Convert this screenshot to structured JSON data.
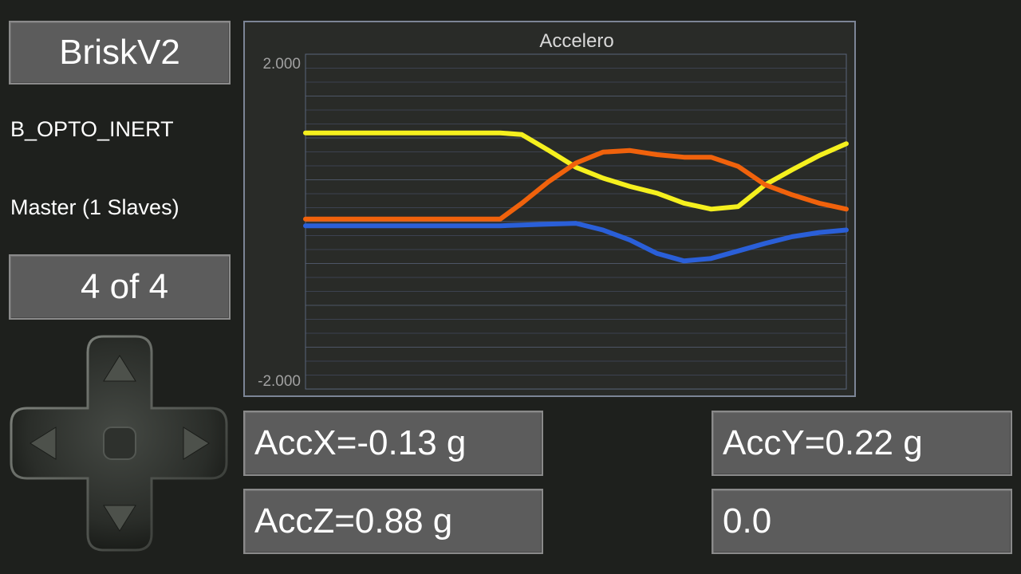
{
  "device": {
    "name": "BriskV2"
  },
  "sensor": {
    "name": "B_OPTO_INERT"
  },
  "network": {
    "role": "Master (1 Slaves)"
  },
  "pager": {
    "label": "4 of 4"
  },
  "dpad": {
    "up": "up-arrow",
    "down": "down-arrow",
    "left": "left-arrow",
    "right": "right-arrow",
    "center": "center-button"
  },
  "readouts": {
    "accx": "AccX=-0.13 g",
    "accy": "AccY=0.22 g",
    "accz": "AccZ=0.88 g",
    "extra": "0.0"
  },
  "colors": {
    "background": "#1e201d",
    "button": "#5c5c5c",
    "series_yellow": "#f5f01e",
    "series_orange": "#f0620c",
    "series_blue": "#2a5fd8"
  },
  "chart_data": {
    "type": "line",
    "title": "Accelero",
    "ylim": [
      -2.0,
      2.0
    ],
    "ytick_labels": [
      "2.000",
      "-2.000"
    ],
    "grid": true,
    "x": [
      0,
      5,
      10,
      15,
      20,
      25,
      30,
      33,
      36,
      40,
      45,
      50,
      55,
      60,
      65,
      70,
      75,
      80,
      85,
      90,
      95,
      100
    ],
    "series": [
      {
        "color": "#f5f01e",
        "values": [
          1.06,
          1.06,
          1.06,
          1.06,
          1.06,
          1.06,
          1.06,
          1.06,
          1.06,
          1.04,
          0.85,
          0.65,
          0.52,
          0.42,
          0.34,
          0.22,
          0.15,
          0.18,
          0.44,
          0.62,
          0.79,
          0.93
        ]
      },
      {
        "color": "#f0620c",
        "values": [
          0.03,
          0.03,
          0.03,
          0.03,
          0.03,
          0.03,
          0.03,
          0.03,
          0.03,
          0.22,
          0.48,
          0.7,
          0.83,
          0.85,
          0.8,
          0.77,
          0.77,
          0.66,
          0.44,
          0.32,
          0.22,
          0.15
        ]
      },
      {
        "color": "#2a5fd8",
        "values": [
          -0.05,
          -0.05,
          -0.05,
          -0.05,
          -0.05,
          -0.05,
          -0.05,
          -0.05,
          -0.05,
          -0.04,
          -0.03,
          -0.02,
          -0.1,
          -0.22,
          -0.38,
          -0.47,
          -0.44,
          -0.35,
          -0.26,
          -0.18,
          -0.13,
          -0.1
        ]
      }
    ]
  }
}
